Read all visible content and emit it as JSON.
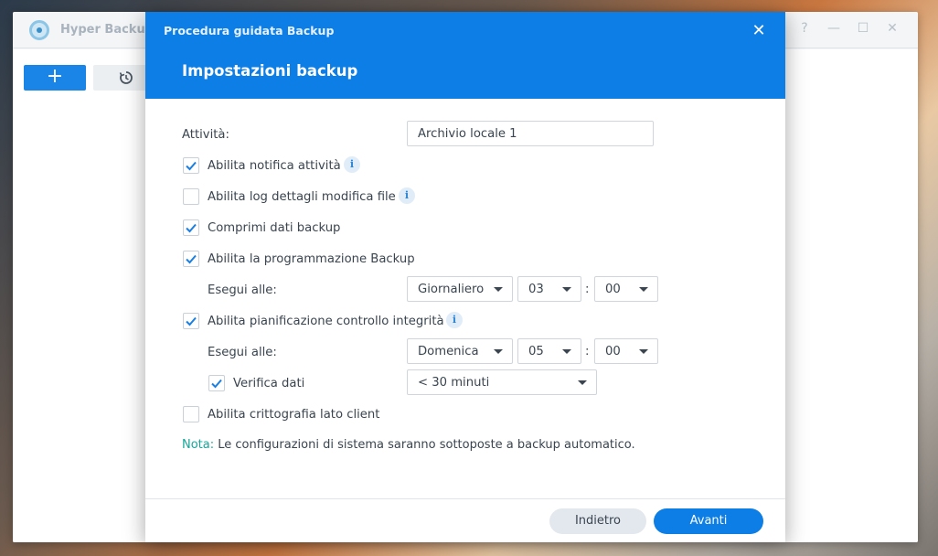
{
  "app": {
    "title": "Hyper Backup",
    "add_label": "+",
    "controls": [
      "?",
      "—",
      "☐",
      "✕"
    ]
  },
  "dialog": {
    "wizard_title": "Procedura guidata Backup",
    "close_label": "✕",
    "step_title": "Impostazioni backup",
    "task_label": "Attività:",
    "task_value": "Archivio locale 1",
    "options": {
      "notify": {
        "label": "Abilita notifica attività",
        "checked": true
      },
      "log": {
        "label": "Abilita log dettagli modifica file",
        "checked": false
      },
      "compress": {
        "label": "Comprimi dati backup",
        "checked": true
      },
      "schedule": {
        "label": "Abilita la programmazione Backup",
        "checked": true
      },
      "integrity": {
        "label": "Abilita pianificazione controllo integrità",
        "checked": true
      },
      "verify": {
        "label": "Verifica dati",
        "checked": true
      },
      "encrypt": {
        "label": "Abilita crittografia lato client",
        "checked": false
      }
    },
    "schedule": {
      "run_label": "Esegui alle:",
      "frequency": "Giornaliero",
      "hour": "03",
      "minute": "00"
    },
    "integrity": {
      "run_label": "Esegui alle:",
      "day": "Domenica",
      "hour": "05",
      "minute": "00",
      "duration": "< 30 minuti"
    },
    "colon": ":",
    "info_glyph": "i",
    "note_label": "Nota:",
    "note_text": " Le configurazioni di sistema saranno sottoposte a backup automatico.",
    "back_label": "Indietro",
    "next_label": "Avanti"
  },
  "colors": {
    "accent": "#0d7ee6",
    "note": "#16a89a"
  }
}
